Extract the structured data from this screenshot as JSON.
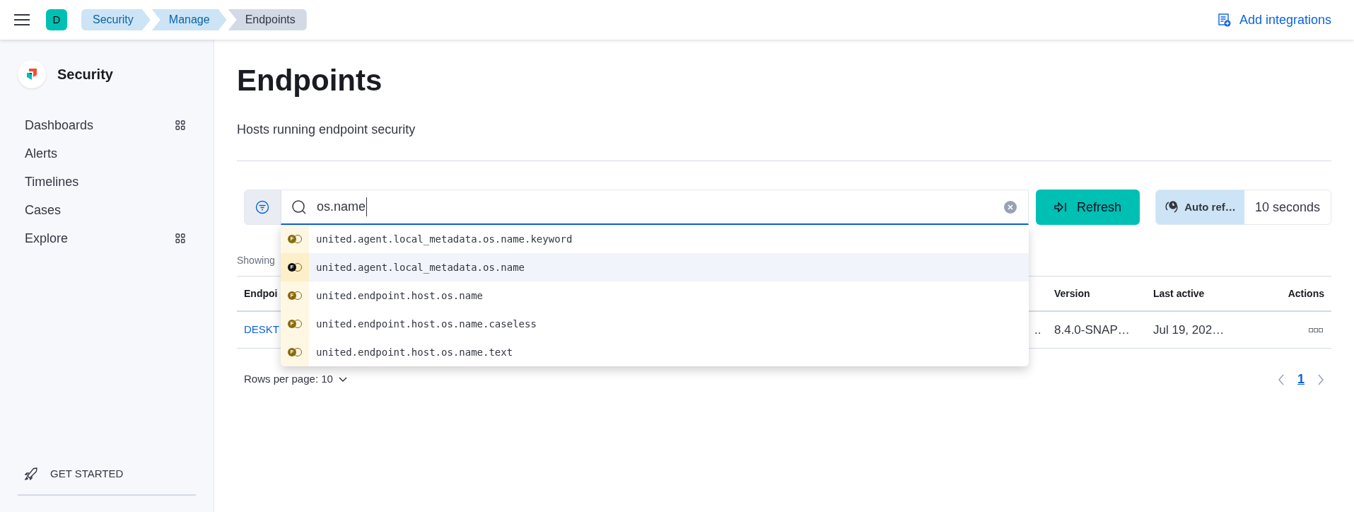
{
  "header": {
    "avatar": "D",
    "breadcrumbs": [
      {
        "label": "Security",
        "current": false
      },
      {
        "label": "Manage",
        "current": false
      },
      {
        "label": "Endpoints",
        "current": true
      }
    ],
    "add_integrations": "Add integrations"
  },
  "sidebar": {
    "title": "Security",
    "items": [
      {
        "label": "Dashboards",
        "has_grid": true
      },
      {
        "label": "Alerts",
        "has_grid": false
      },
      {
        "label": "Timelines",
        "has_grid": false
      },
      {
        "label": "Cases",
        "has_grid": false
      },
      {
        "label": "Explore",
        "has_grid": true
      }
    ],
    "get_started": "GET STARTED"
  },
  "page": {
    "title": "Endpoints",
    "subtitle": "Hosts running endpoint security"
  },
  "search": {
    "value": "os.name",
    "suggestions": [
      {
        "icon_letter": "F",
        "label": "united.agent.local_metadata.os.name.keyword",
        "selected": false
      },
      {
        "icon_letter": "F",
        "label": "united.agent.local_metadata.os.name",
        "selected": true
      },
      {
        "icon_letter": "F",
        "label": "united.endpoint.host.os.name",
        "selected": false
      },
      {
        "icon_letter": "F",
        "label": "united.endpoint.host.os.name.caseless",
        "selected": false
      },
      {
        "icon_letter": "F",
        "label": "united.endpoint.host.os.name.text",
        "selected": false
      }
    ]
  },
  "refresh_button": "Refresh",
  "auto_refresh": {
    "label": "Auto ref…",
    "interval": "10 seconds"
  },
  "showing": "Showing",
  "table": {
    "columns": [
      "Endpoi",
      "",
      "Version",
      "Last active",
      "Actions"
    ],
    "rows": [
      {
        "cells": [
          "DESKT",
          "..",
          "8.4.0-SNAP…",
          "Jul 19, 202…"
        ]
      }
    ]
  },
  "pagination": {
    "rows_per_page": "Rows per page: 10",
    "pages": [
      {
        "label": "1",
        "selected": true
      }
    ]
  }
}
